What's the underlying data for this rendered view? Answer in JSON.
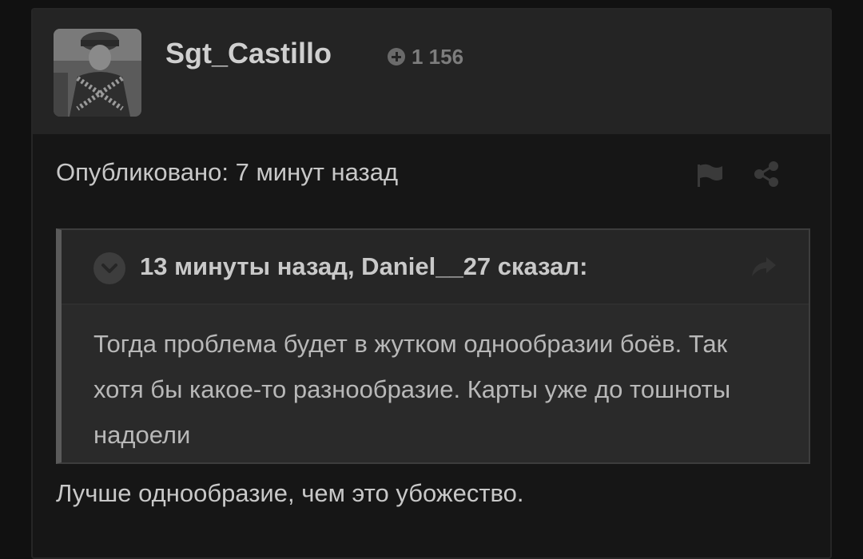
{
  "post": {
    "author": {
      "username": "Sgt_Castillo",
      "reputation": "1 156",
      "avatar_icon": "soldier-avatar"
    },
    "published": "Опубликовано: 7 минут назад",
    "actions": {
      "report_icon": "flag-icon",
      "share_icon": "share-icon"
    },
    "quote": {
      "header": "13 минуты назад, Daniel__27 сказал:",
      "text": "Тогда проблема будет в жутком однообразии боёв. Так хотя бы какое-то разнообразие. Карты уже до тошноты надоели"
    },
    "reply_text": "Лучше однообразие, чем это убожество."
  },
  "colors": {
    "page_bg": "#111111",
    "post_bg": "#161616",
    "header_bg": "#242424",
    "quote_bg": "#2a2a2a",
    "text": "#c8c8c8"
  }
}
